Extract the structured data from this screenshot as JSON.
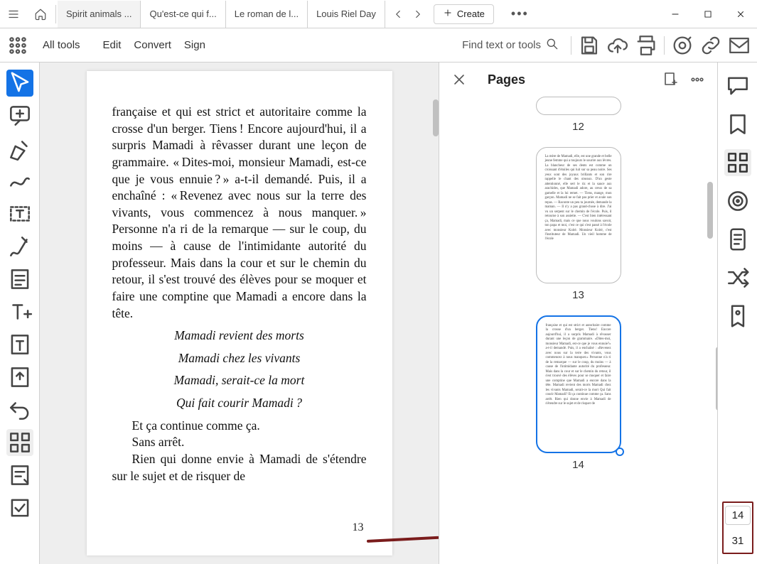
{
  "tabs": [
    {
      "label": "Spirit animals ..."
    },
    {
      "label": "Qu'est-ce qui f..."
    },
    {
      "label": "Le roman de l..."
    },
    {
      "label": "Louis Riel Day"
    }
  ],
  "titlebar": {
    "create": "Create"
  },
  "toolbar": {
    "all_tools": "All tools",
    "edit": "Edit",
    "convert": "Convert",
    "sign": "Sign",
    "find": "Find text or tools"
  },
  "document": {
    "para1": "française et qui est strict et autoritaire comme la crosse d'un berger. Tiens ! Encore aujourd'hui, il a surpris Mamadi à rêvasser durant une leçon de grammaire. « Dites-moi, monsieur Mamadi, est-ce que je vous ennuie ? » a-t-il demandé. Puis, il a enchaîné : « Revenez avec nous sur la terre des vivants, vous commencez à nous manquer. » Personne n'a ri de la remarque — sur le coup, du moins — à cause de l'intimidante autorité du professeur. Mais dans la cour et sur le chemin du retour, il s'est trouvé des élèves pour se moquer et faire une comptine que Mamadi a encore dans la tête.",
    "verse1": "Mamadi revient des morts",
    "verse2": "Mamadi chez les vivants",
    "verse3": "Mamadi, serait-ce la mort",
    "verse4": "Qui fait courir Mamadi ?",
    "cont1": "Et ça continue comme ça.",
    "cont2": "Sans arrêt.",
    "cont3": "Rien qui donne envie à Mamadi de s'étendre sur le sujet et de risquer de",
    "page_number": "13"
  },
  "pages_panel": {
    "title": "Pages",
    "thumbs": [
      {
        "num": "12",
        "state": "partial"
      },
      {
        "num": "13",
        "state": "full",
        "text": "La mère de Mamadi, elle, est une grande et belle jeune femme qui a toujours le sourire aux lèvres. La blancheur de ses dents est comme un croissant d'étoiles qui luit sur sa peau noire. Ses yeux sont des joyaux brillants et son rire rappelle le chant des oiseaux. D'un geste attentionné, elle sert le riz et la sauce aux arachides, que Mamadi adore, au creux de sa gamelle et la lui remet. — Tiens, mange, mon garçon. Mamadi ne se fait pas prier et avale son repas. — Raconte un peu ta journée, demande la maman. — Il n'y a pas grand-chose à dire. J'ai vu un serpent sur le chemin de l'école. Puis, il retourne à son assiette. — C'est bien intéressant ça, Mamadi, mais ce que nous voulons savoir, ton papa et moi, c'est ce qui s'est passé à l'école avec monsieur Koité. Monsieur Koité, c'est l'instituteur de Mamadi. Un vieil homme de l'école"
      },
      {
        "num": "14",
        "state": "selected",
        "text": "française et qui est strict et autoritaire comme la crosse d'un berger. Tiens! Encore aujourd'hui, il a surpris Mamadi à rêvasser durant une leçon de grammaire. «Dites-moi, monsieur Mamadi, est-ce que je vous ennuie?» a-t-il demandé. Puis, il a enchaîné : «Revenez avec nous sur la terre des vivants, vous commencez à nous manquer.» Personne n'a ri de la remarque — sur le coup, du moins — à cause de l'intimidante autorité du professeur. Mais dans la cour et sur le chemin du retour, il s'est trouvé des élèves pour se moquer et faire une comptine que Mamadi a encore dans la tête. Mamadi revient des morts Mamadi chez les vivants Mamadi, serait-ce la mort Qui fait courir Mamadi? Et ça continue comme ça. Sans arrêt. Rien qui donne envie à Mamadi de s'étendre sur le sujet et de risquer de"
      }
    ]
  },
  "floating": {
    "cur": "14",
    "total": "31"
  }
}
